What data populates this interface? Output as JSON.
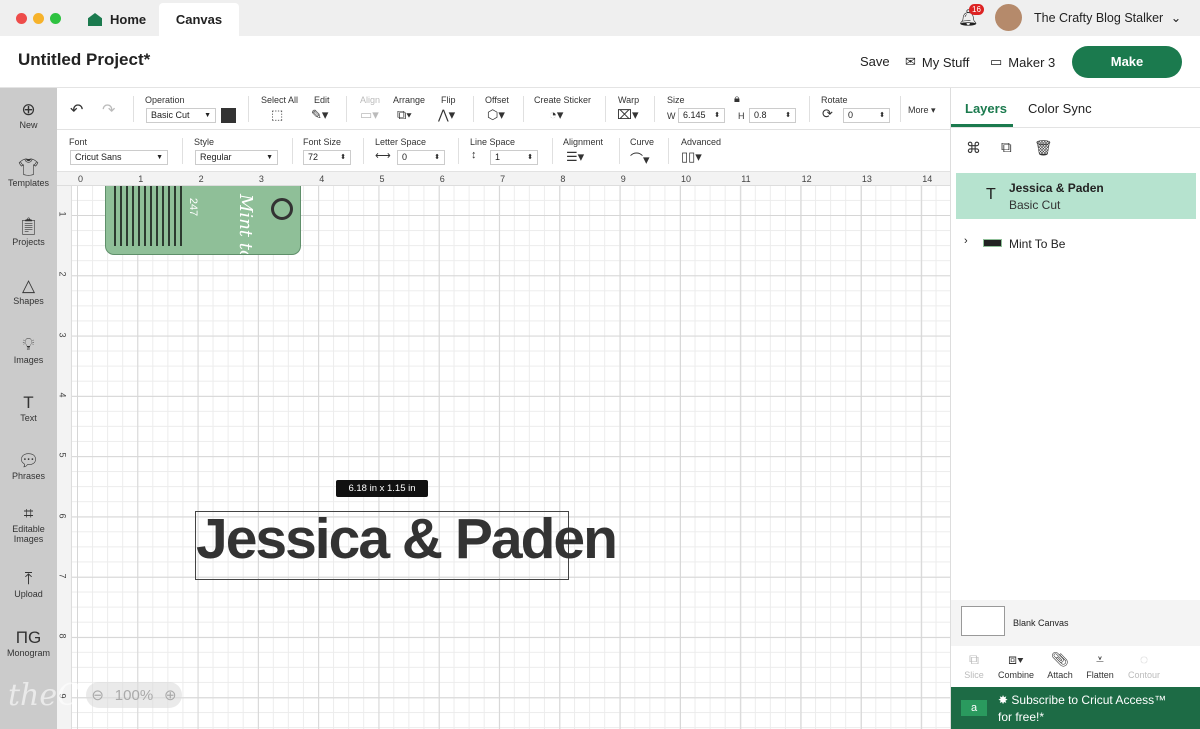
{
  "window": {
    "tabs": [
      {
        "label": "Home",
        "icon": "home-icon"
      },
      {
        "label": "Canvas"
      }
    ],
    "notification_count": "16",
    "user_name": "The Crafty Blog Stalker"
  },
  "header": {
    "title": "Untitled Project*",
    "save": "Save",
    "my_stuff": "My Stuff",
    "machine": "Maker 3",
    "make": "Make"
  },
  "sidebar": {
    "items": [
      {
        "label": "New"
      },
      {
        "label": "Templates"
      },
      {
        "label": "Projects"
      },
      {
        "label": "Shapes"
      },
      {
        "label": "Images"
      },
      {
        "label": "Text"
      },
      {
        "label": "Phrases"
      },
      {
        "label": "Editable Images"
      },
      {
        "label": "Upload"
      },
      {
        "label": "Monogram"
      }
    ]
  },
  "toolbar": {
    "operation_label": "Operation",
    "operation_value": "Basic Cut",
    "operation_color": "#333333",
    "select_all": "Select All",
    "edit": "Edit",
    "align": "Align",
    "arrange": "Arrange",
    "flip": "Flip",
    "offset": "Offset",
    "create_sticker": "Create Sticker",
    "warp": "Warp",
    "size_label": "Size",
    "w_label": "W",
    "w_value": "6.145",
    "h_label": "H",
    "h_value": "0.8",
    "rotate_label": "Rotate",
    "rotate_value": "0",
    "more": "More"
  },
  "text_toolbar": {
    "font_label": "Font",
    "font_value": "Cricut Sans",
    "style_label": "Style",
    "style_value": "Regular",
    "font_size_label": "Font Size",
    "font_size_value": "72",
    "letter_space_label": "Letter Space",
    "letter_space_value": "0",
    "line_space_label": "Line Space",
    "line_space_value": "1",
    "alignment_label": "Alignment",
    "curve_label": "Curve",
    "advanced_label": "Advanced"
  },
  "ruler": {
    "h": [
      "0",
      "1",
      "2",
      "3",
      "4",
      "5",
      "6",
      "7",
      "8",
      "9",
      "10",
      "11",
      "12",
      "13",
      "14"
    ],
    "v": [
      "1",
      "2",
      "3",
      "4",
      "5",
      "6",
      "7",
      "8",
      "9"
    ]
  },
  "canvas": {
    "text": "Jessica & Paden",
    "tooltip": "6.18  in x 1.15  in",
    "zoom": "100%",
    "mint_color": "#8fbf98",
    "mint_text": "Mint to Be",
    "mint_number": "247",
    "watermark": "theC"
  },
  "layers_panel": {
    "tabs": [
      "Layers",
      "Color Sync"
    ],
    "layers": [
      {
        "name": "Jessica & Paden",
        "sub": "Basic Cut",
        "selected": true
      },
      {
        "name": "Mint To Be"
      }
    ],
    "blank_canvas": "Blank Canvas",
    "tools": [
      {
        "label": "Slice",
        "enabled": false
      },
      {
        "label": "Combine",
        "enabled": true
      },
      {
        "label": "Attach",
        "enabled": true
      },
      {
        "label": "Flatten",
        "enabled": true
      },
      {
        "label": "Contour",
        "enabled": false
      }
    ],
    "banner_line1": "Subscribe to Cricut Access™",
    "banner_line2": "for free!*"
  },
  "colors": {
    "brand": "#1b7a4e",
    "selected_layer": "#b6e3cf",
    "banner": "#1d6b45"
  }
}
